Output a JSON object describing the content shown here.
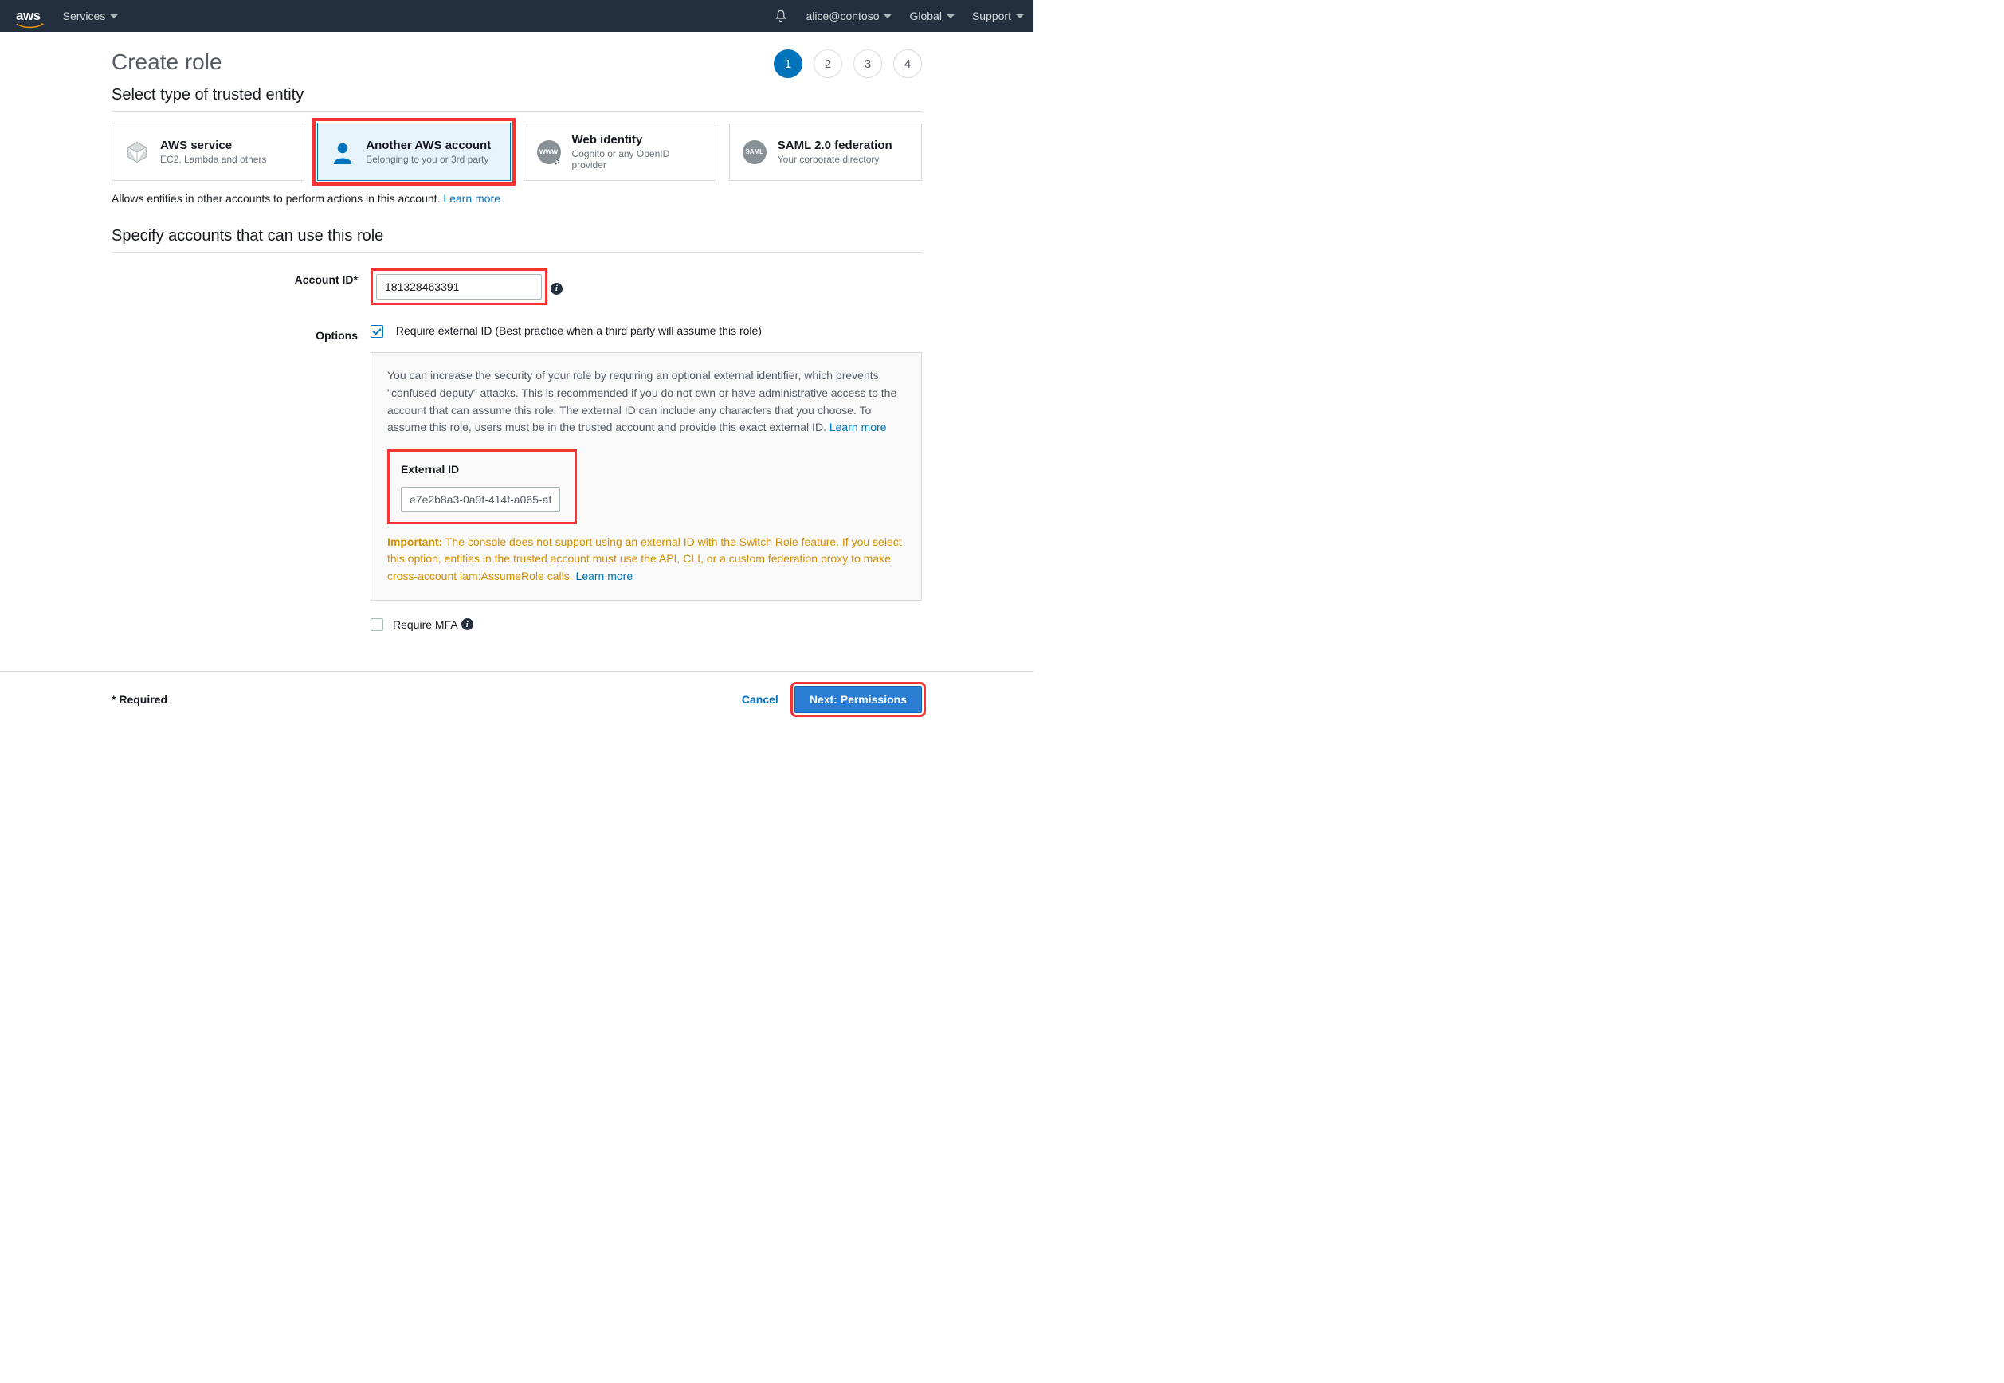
{
  "nav": {
    "services": "Services",
    "user": "alice@contoso",
    "region": "Global",
    "support": "Support"
  },
  "page": {
    "title": "Create role",
    "steps": [
      "1",
      "2",
      "3",
      "4"
    ],
    "active_step": 0
  },
  "section_entity": {
    "heading": "Select type of trusted entity",
    "cards": [
      {
        "title": "AWS service",
        "sub": "EC2, Lambda and others"
      },
      {
        "title": "Another AWS account",
        "sub": "Belonging to you or 3rd party"
      },
      {
        "title": "Web identity",
        "sub": "Cognito or any OpenID provider"
      },
      {
        "title": "SAML 2.0 federation",
        "sub": "Your corporate directory"
      }
    ],
    "icons": {
      "www": "www",
      "saml": "SAML"
    },
    "desc": "Allows entities in other accounts to perform actions in this account. ",
    "learn_more": "Learn more"
  },
  "section_accounts": {
    "heading": "Specify accounts that can use this role",
    "account_id_label": "Account ID*",
    "account_id_value": "181328463391",
    "options_label": "Options",
    "require_ext_id": "Require external ID (Best practice when a third party will assume this role)",
    "detail_text": "You can increase the security of your role by requiring an optional external identifier, which prevents \"confused deputy\" attacks. This is recommended if you do not own or have administrative access to the account that can assume this role. The external ID can include any characters that you choose. To assume this role, users must be in the trusted account and provide this exact external ID. ",
    "learn_more": "Learn more",
    "external_id_label": "External ID",
    "external_id_value": "e7e2b8a3-0a9f-414f-a065-af",
    "important_label": "Important:",
    "important_text": " The console does not support using an external ID with the Switch Role feature. If you select this option, entities in the trusted account must use the API, CLI, or a custom federation proxy to make cross-account iam:AssumeRole calls. ",
    "require_mfa": "Require MFA"
  },
  "footer": {
    "required": "* Required",
    "cancel": "Cancel",
    "next": "Next: Permissions"
  }
}
